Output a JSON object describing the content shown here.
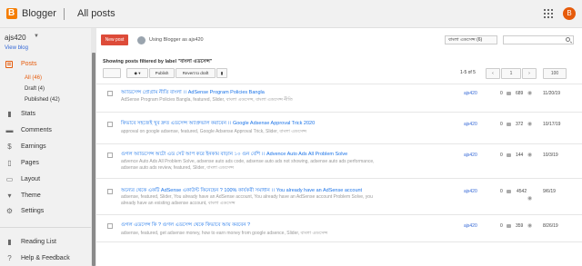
{
  "header": {
    "brand": "Blogger",
    "title": "All posts",
    "avatar_letter": "B",
    "brand_color": "#f57d00",
    "accent_color": "#e65b0b"
  },
  "sidebar": {
    "blog_name": "ajs420",
    "view_blog": "View blog",
    "items": [
      {
        "label": "Posts",
        "icon": "posts-icon",
        "active": true
      },
      {
        "label": "Stats",
        "icon": "stats-icon"
      },
      {
        "label": "Comments",
        "icon": "comments-icon"
      },
      {
        "label": "Earnings",
        "icon": "earnings-icon"
      },
      {
        "label": "Pages",
        "icon": "pages-icon"
      },
      {
        "label": "Layout",
        "icon": "layout-icon"
      },
      {
        "label": "Theme",
        "icon": "theme-icon"
      },
      {
        "label": "Settings",
        "icon": "gear-icon"
      },
      {
        "label": "Reading List",
        "icon": "bookmark-icon"
      },
      {
        "label": "Help & Feedback",
        "icon": "help-icon"
      }
    ],
    "subitems": [
      {
        "label": "All (46)",
        "active": true
      },
      {
        "label": "Draft (4)"
      },
      {
        "label": "Published (42)"
      }
    ]
  },
  "toolbar": {
    "new_post": "New post",
    "user_text": "Using Blogger as ajs420",
    "language_select": "বাংলা এডসেন্স (6)",
    "filter_text": "Showing posts filtered by label \"বাংলা এডসেন্স\"",
    "label_button": "▾",
    "publish": "Publish",
    "revert": "Revert to draft",
    "range": "1-5 of 5",
    "page": "1",
    "per_page": "100"
  },
  "posts": [
    {
      "title": "অ্যাডসেন্স প্রোগ্রাম নীতি বাংলা ।। AdSense Program Policies Bangla",
      "labels": "AdSense Program Policies Bangla, featured, Slider, বাংলা এডসেন্স, বাংলা এডসেন্স নীতি",
      "author": "ajs420",
      "comments": "0",
      "views": "689",
      "date": "11/20/19"
    },
    {
      "title": "কিভাবে সহজেই খুব দ্রুত এডসেন্স অ্যাপ্রুভাল করাবেন ।। Google Adsense Approval Trick 2020",
      "labels": "approval on google adsense, featured, Google Adsense Approval Trick, Slider, বাংলা এডসেন্স",
      "author": "ajs420",
      "comments": "0",
      "views": "372",
      "date": "10/17/19"
    },
    {
      "title": "গুগল অ্যাডসেন্স অটো এড সেট আপ করে ইনকাম বাড়ান ১০ গুন বেশি ।। Advence Auto Ads All Problem Solve",
      "labels": "advence Auto Ads All Problem Solve, adsense auto ads code, adsense auto ads not showing, adsense auto ads performance, adsense auto ads review, featured, Slider, বাংলা এডসেন্স",
      "author": "ajs420",
      "comments": "0",
      "views": "144",
      "date": "10/3/19"
    },
    {
      "title": "অন্যের থেকে একটি AdSense একাউন্ট কিনেছেন ? 100% কার্যকরী সমাধান ।। You already have an AdSense account",
      "labels": "adsense, featured, Slider, You already have an AdSense account, You already have an AdSense account Problem Solve, you already have an existing adsense account, বাংলা এডসেন্স",
      "author": "ajs420",
      "comments": "0",
      "views": "4542",
      "date": "9/6/19"
    },
    {
      "title": "গুগল এডসেন্স কি ? গুগল এডসেন্স থেকে কিভাবে আয় করবেন ?",
      "labels": "adsense, featured, get adsense money, how to earn money from google adsence, Slider, বাংলা এডসেন্স",
      "author": "ajs420",
      "comments": "0",
      "views": "359",
      "date": "8/26/19"
    }
  ]
}
